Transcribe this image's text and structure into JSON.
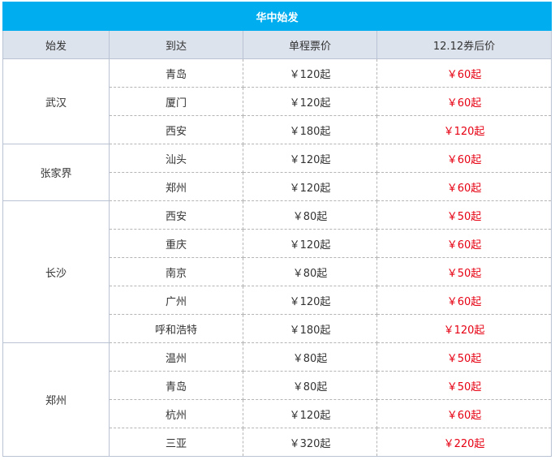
{
  "title": "华中始发",
  "headers": [
    "始发",
    "到达",
    "单程票价",
    "12.12券后价"
  ],
  "groups": [
    {
      "origin": "武汉",
      "rows": [
        {
          "to": "青岛",
          "price": "￥120起",
          "after": "￥60起"
        },
        {
          "to": "厦门",
          "price": "￥120起",
          "after": "￥60起"
        },
        {
          "to": "西安",
          "price": "￥180起",
          "after": "￥120起"
        }
      ]
    },
    {
      "origin": "张家界",
      "rows": [
        {
          "to": "汕头",
          "price": "￥120起",
          "after": "￥60起"
        },
        {
          "to": "郑州",
          "price": "￥120起",
          "after": "￥60起"
        }
      ]
    },
    {
      "origin": "长沙",
      "rows": [
        {
          "to": "西安",
          "price": "￥80起",
          "after": "￥50起"
        },
        {
          "to": "重庆",
          "price": "￥120起",
          "after": "￥60起"
        },
        {
          "to": "南京",
          "price": "￥80起",
          "after": "￥50起"
        },
        {
          "to": "广州",
          "price": "￥120起",
          "after": "￥60起"
        },
        {
          "to": "呼和浩特",
          "price": "￥180起",
          "after": "￥120起"
        }
      ]
    },
    {
      "origin": "郑州",
      "rows": [
        {
          "to": "温州",
          "price": "￥80起",
          "after": "￥50起"
        },
        {
          "to": "青岛",
          "price": "￥80起",
          "after": "￥50起"
        },
        {
          "to": "杭州",
          "price": "￥120起",
          "after": "￥60起"
        },
        {
          "to": "三亚",
          "price": "￥320起",
          "after": "￥220起"
        }
      ]
    }
  ],
  "colors": {
    "title_bg": "#00aeef",
    "header_bg": "#dde3ed",
    "after_price": "#e60012"
  }
}
